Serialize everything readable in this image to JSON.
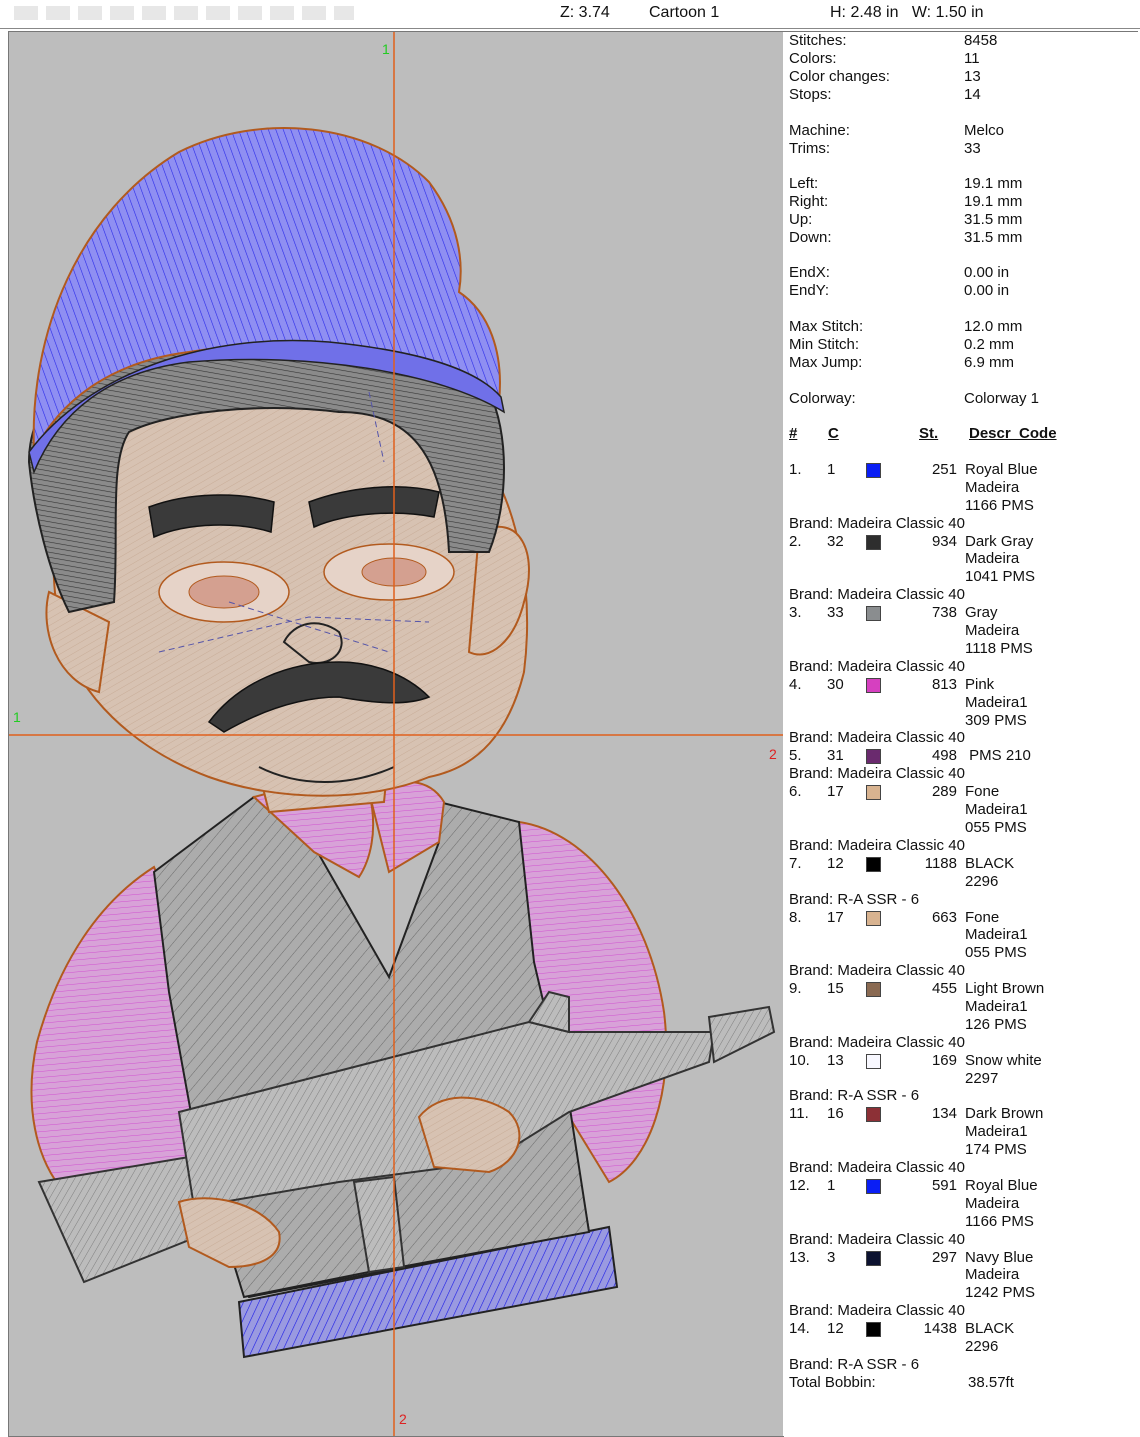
{
  "topbar": {
    "zoom": "Z: 3.74",
    "design_name": "Cartoon 1",
    "size": "H: 2.48 in   W: 1.50 in"
  },
  "canvas": {
    "guide_top_label": "1",
    "guide_left_label": "1",
    "guide_right_label": "2",
    "guide_bottom_label": "2",
    "colors": {
      "background": "#bdbdbd",
      "guide": "#e0601c",
      "guide_label_green": "#22cc22",
      "guide_label_red": "#dd2222",
      "cap": "#8c8cf0",
      "hair": "#6e6e6e",
      "skin": "#d9c3b3",
      "shirt": "#d79ad7",
      "vest": "#a9a9a9",
      "outline": "#b25a1e"
    }
  },
  "stats": [
    {
      "label": "Stitches:",
      "value": "8458"
    },
    {
      "label": "Colors:",
      "value": "11"
    },
    {
      "label": "Color changes:",
      "value": "13"
    },
    {
      "label": "Stops:",
      "value": "14"
    },
    {
      "label": "Machine:",
      "value": "Melco"
    },
    {
      "label": "Trims:",
      "value": "33"
    },
    {
      "label": "Left:",
      "value": "19.1 mm"
    },
    {
      "label": "Right:",
      "value": "19.1 mm"
    },
    {
      "label": "Up:",
      "value": "31.5 mm"
    },
    {
      "label": "Down:",
      "value": "31.5 mm"
    },
    {
      "label": "EndX:",
      "value": "0.00 in"
    },
    {
      "label": "EndY:",
      "value": "0.00 in"
    },
    {
      "label": "Max Stitch:",
      "value": "12.0 mm"
    },
    {
      "label": "Min Stitch:",
      "value": "0.2 mm"
    },
    {
      "label": "Max Jump:",
      "value": "6.9 mm"
    },
    {
      "label": "Colorway:",
      "value": "Colorway 1"
    }
  ],
  "table_headers": {
    "num": "#",
    "c": "C",
    "st": "St.",
    "desc": "Descr  Code"
  },
  "color_list": [
    {
      "num": "1.",
      "c": "1",
      "color": "#0a1ef5",
      "st": "251",
      "desc": [
        "Royal Blue",
        "Madeira",
        "1166 PMS"
      ],
      "brand": "Brand: Madeira Classic 40"
    },
    {
      "num": "2.",
      "c": "32",
      "color": "#2e2e2e",
      "st": "934",
      "desc": [
        "Dark Gray",
        "Madeira",
        "1041 PMS"
      ],
      "brand": "Brand: Madeira Classic 40"
    },
    {
      "num": "3.",
      "c": "33",
      "color": "#8a8d8f",
      "st": "738",
      "desc": [
        "Gray",
        "Madeira",
        "1118 PMS"
      ],
      "brand": "Brand: Madeira Classic 40"
    },
    {
      "num": "4.",
      "c": "30",
      "color": "#d640c0",
      "st": "813",
      "desc": [
        "Pink",
        "Madeira1",
        "309 PMS"
      ],
      "brand": "Brand: Madeira Classic 40"
    },
    {
      "num": "5.",
      "c": "31",
      "color": "#6a2a6e",
      "st": "498",
      "desc": [
        " PMS 210"
      ],
      "brand": "Brand: Madeira Classic 40"
    },
    {
      "num": "6.",
      "c": "17",
      "color": "#d8b390",
      "st": "289",
      "desc": [
        "Fone",
        "Madeira1",
        "055 PMS"
      ],
      "brand": "Brand: Madeira Classic 40"
    },
    {
      "num": "7.",
      "c": "12",
      "color": "#000000",
      "st": "1188",
      "desc": [
        "BLACK",
        "2296"
      ],
      "brand": "Brand: R-A SSR - 6"
    },
    {
      "num": "8.",
      "c": "17",
      "color": "#d8b390",
      "st": "663",
      "desc": [
        "Fone",
        "Madeira1",
        "055 PMS"
      ],
      "brand": "Brand: Madeira Classic 40"
    },
    {
      "num": "9.",
      "c": "15",
      "color": "#8a6a52",
      "st": "455",
      "desc": [
        "Light Brown",
        "Madeira1",
        "126 PMS"
      ],
      "brand": "Brand: Madeira Classic 40"
    },
    {
      "num": "10.",
      "c": "13",
      "color": "#f8f8ff",
      "st": "169",
      "desc": [
        "Snow white",
        "2297"
      ],
      "brand": "Brand: R-A SSR - 6"
    },
    {
      "num": "11.",
      "c": "16",
      "color": "#8c3036",
      "st": "134",
      "desc": [
        "Dark Brown",
        "Madeira1",
        "174 PMS"
      ],
      "brand": "Brand: Madeira Classic 40"
    },
    {
      "num": "12.",
      "c": "1",
      "color": "#0a1ef5",
      "st": "591",
      "desc": [
        "Royal Blue",
        "Madeira",
        "1166 PMS"
      ],
      "brand": "Brand: Madeira Classic 40"
    },
    {
      "num": "13.",
      "c": "3",
      "color": "#0c1230",
      "st": "297",
      "desc": [
        "Navy Blue",
        "Madeira",
        "1242 PMS"
      ],
      "brand": "Brand: Madeira Classic 40"
    },
    {
      "num": "14.",
      "c": "12",
      "color": "#000000",
      "st": "1438",
      "desc": [
        "BLACK",
        "2296"
      ],
      "brand": "Brand: R-A SSR - 6"
    }
  ],
  "bobbin": {
    "label": "Total Bobbin:",
    "value": "38.57ft"
  }
}
